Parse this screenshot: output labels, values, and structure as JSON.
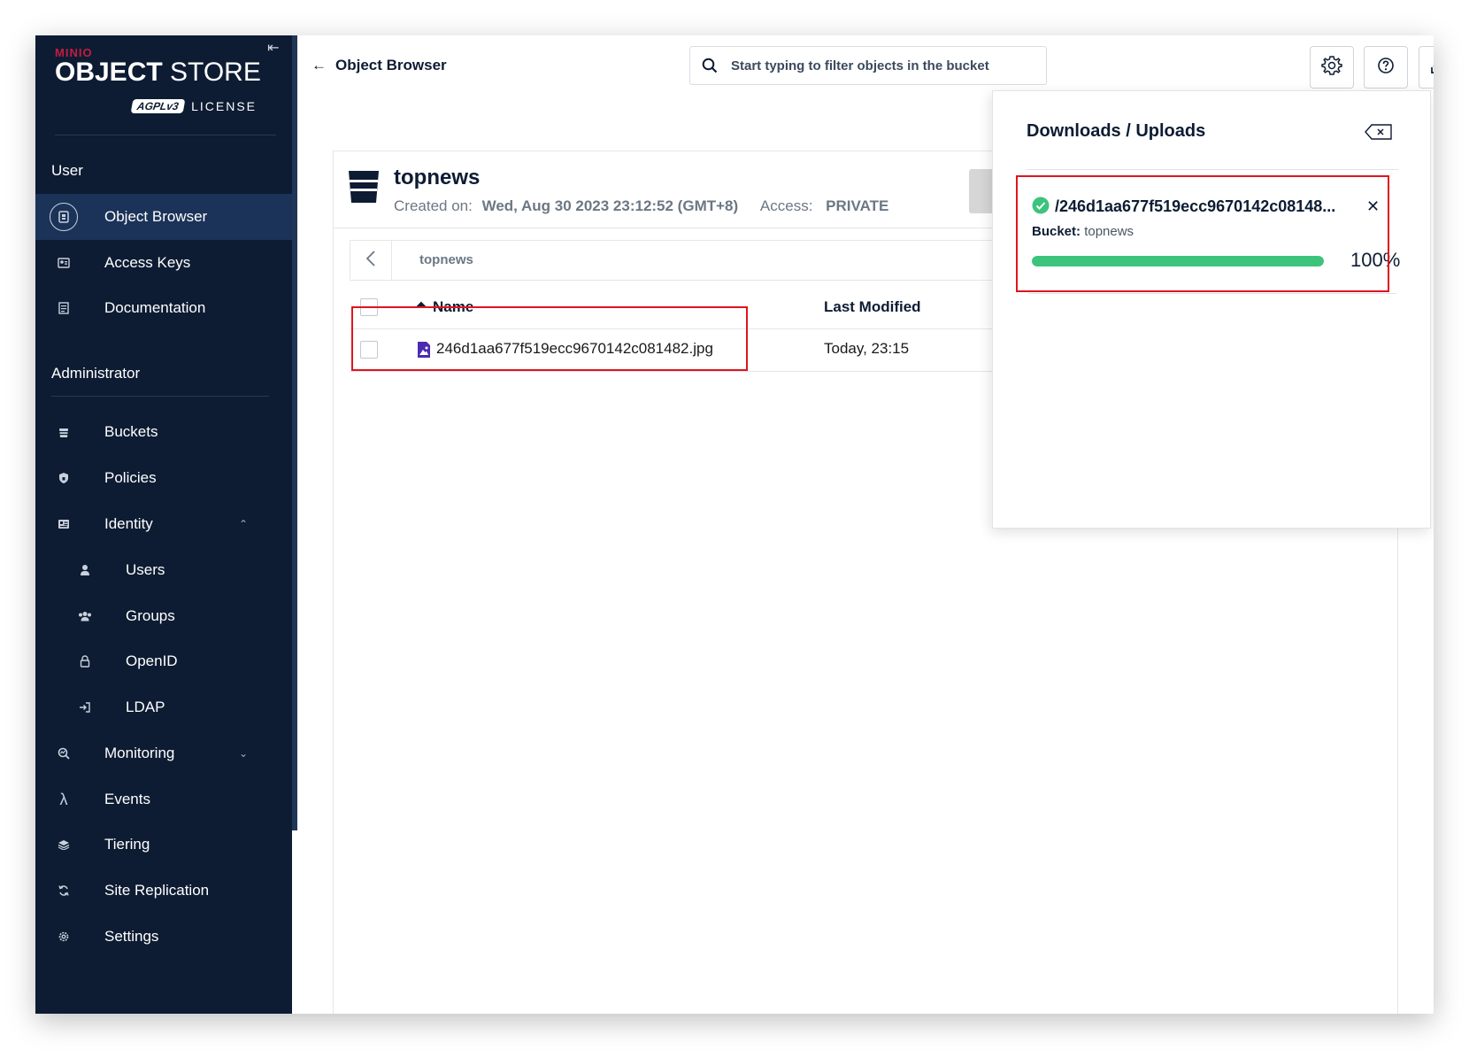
{
  "brand": {
    "minio": "MINIO",
    "title_bold": "OBJECT",
    "title_light": " STORE",
    "agpl": "AGPLv3",
    "license": "LICENSE"
  },
  "sidebar": {
    "user_section": "User",
    "admin_section": "Administrator",
    "user_items": [
      {
        "label": "Object Browser",
        "icon": "object-browser-icon",
        "active": true
      },
      {
        "label": "Access Keys",
        "icon": "key-icon"
      },
      {
        "label": "Documentation",
        "icon": "document-icon"
      }
    ],
    "admin_items": [
      {
        "label": "Buckets",
        "icon": "bucket-icon"
      },
      {
        "label": "Policies",
        "icon": "shield-icon"
      },
      {
        "label": "Identity",
        "icon": "identity-icon",
        "expanded": true
      },
      {
        "label": "Users",
        "icon": "user-icon"
      },
      {
        "label": "Groups",
        "icon": "group-icon"
      },
      {
        "label": "OpenID",
        "icon": "lock-icon"
      },
      {
        "label": "LDAP",
        "icon": "login-icon"
      },
      {
        "label": "Monitoring",
        "icon": "monitoring-icon",
        "expanded": false
      },
      {
        "label": "Events",
        "icon": "lambda-icon"
      },
      {
        "label": "Tiering",
        "icon": "layers-icon"
      },
      {
        "label": "Site Replication",
        "icon": "sync-icon"
      },
      {
        "label": "Settings",
        "icon": "gear-icon"
      }
    ]
  },
  "header": {
    "back_label": "Object Browser",
    "search_placeholder": "Start typing to filter objects in the bucket"
  },
  "bucket": {
    "name": "topnews",
    "created_label": "Created on:",
    "created_value": "Wed, Aug 30 2023 23:12:52 (GMT+8)",
    "access_label": "Access:",
    "access_value": "PRIVATE",
    "breadcrumb": "topnews"
  },
  "table": {
    "headers": {
      "name": "Name",
      "last_modified": "Last Modified"
    },
    "rows": [
      {
        "name": "246d1aa677f519ecc9670142c081482.jpg",
        "last_modified": "Today, 23:15"
      }
    ]
  },
  "downloads": {
    "title": "Downloads / Uploads",
    "items": [
      {
        "path": "/246d1aa677f519ecc9670142c08148...",
        "bucket_label": "Bucket:",
        "bucket_value": "topnews",
        "progress": 1.0,
        "progress_label": "100%"
      }
    ]
  },
  "colors": {
    "sidebar_bg": "#0d1c33",
    "active_item": "#1b3358",
    "progress": "#3cc47c",
    "highlight": "#e0141f"
  }
}
